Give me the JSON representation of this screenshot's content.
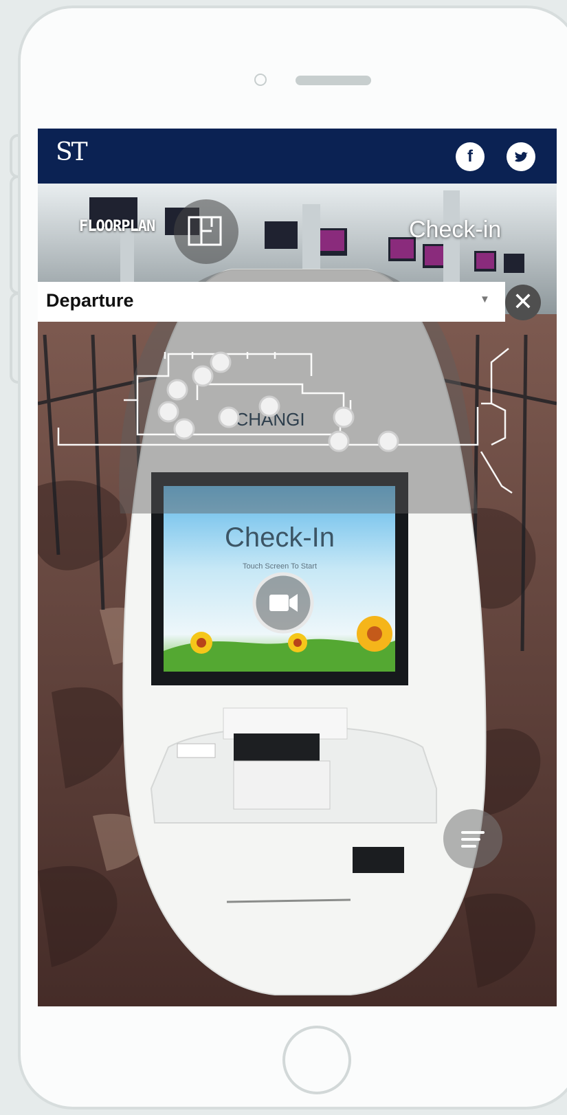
{
  "header": {
    "logo_text": "ST",
    "facebook_icon": "facebook-icon",
    "twitter_icon": "twitter-icon",
    "brand_color": "#0b2253"
  },
  "floorplan": {
    "label": "FLOORPLAN",
    "icon": "floorplan-icon"
  },
  "section_title": "Check-in",
  "selector": {
    "value": "Departure",
    "caret_icon": "caret-down-icon"
  },
  "close": {
    "label": "✕",
    "icon": "close-icon"
  },
  "kiosk": {
    "screen_title": "Check-In",
    "screen_subtitle": "Touch Screen To Start",
    "map_brand": "CHANGI",
    "video_icon": "video-camera-icon"
  },
  "menu": {
    "icon": "menu-icon"
  }
}
